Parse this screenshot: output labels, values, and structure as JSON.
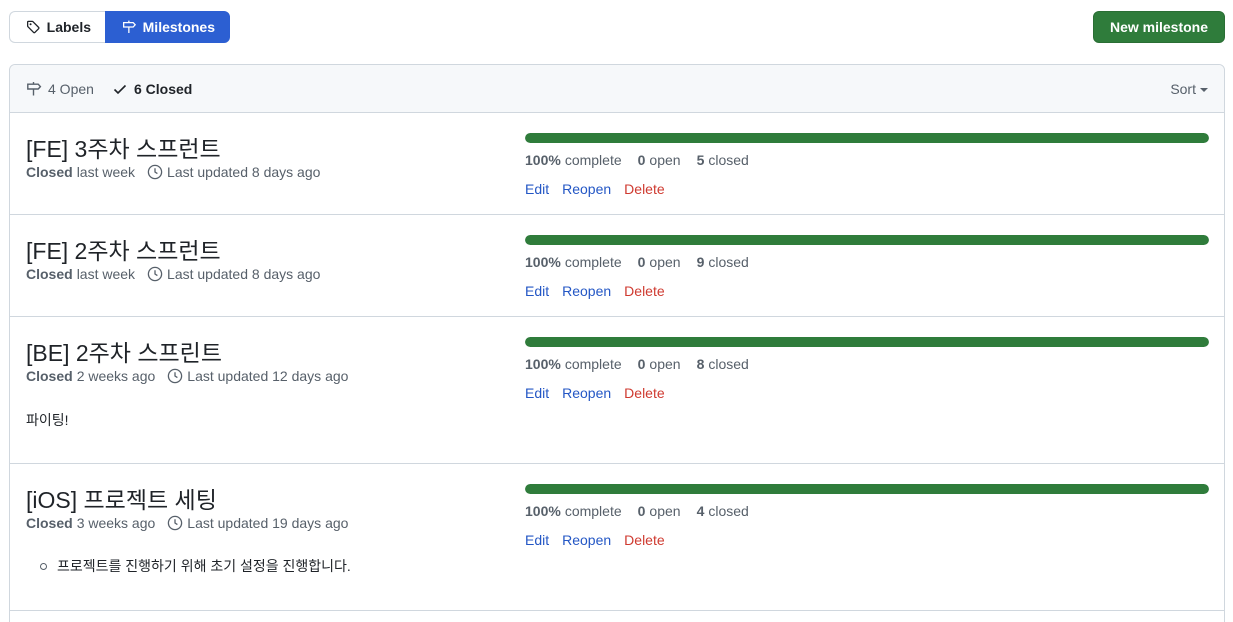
{
  "tabs": {
    "labels": "Labels",
    "milestones": "Milestones"
  },
  "new_milestone": "New milestone",
  "filter": {
    "open": "4 Open",
    "closed": "6 Closed",
    "sort": "Sort"
  },
  "colors": {
    "primary": "#2c5fd2",
    "success": "#2f7c3b",
    "danger": "#cf3a30",
    "link": "#2457c5"
  },
  "milestones": [
    {
      "title": "[FE] 3주차 스프런트",
      "closed_label": "Closed",
      "closed_when": "last week",
      "updated": "Last updated 8 days ago",
      "progress": 1.0,
      "percent": "100%",
      "percent_label": "complete",
      "open_count": "0",
      "open_label": "open",
      "closed_count": "5",
      "closed_text": "closed",
      "description": "",
      "description_list": [],
      "edit": "Edit",
      "reopen": "Reopen",
      "delete": "Delete"
    },
    {
      "title": "[FE] 2주차 스프런트",
      "closed_label": "Closed",
      "closed_when": "last week",
      "updated": "Last updated 8 days ago",
      "progress": 1.0,
      "percent": "100%",
      "percent_label": "complete",
      "open_count": "0",
      "open_label": "open",
      "closed_count": "9",
      "closed_text": "closed",
      "description": "",
      "description_list": [],
      "edit": "Edit",
      "reopen": "Reopen",
      "delete": "Delete"
    },
    {
      "title": "[BE] 2주차 스프린트",
      "closed_label": "Closed",
      "closed_when": "2 weeks ago",
      "updated": "Last updated 12 days ago",
      "progress": 1.0,
      "percent": "100%",
      "percent_label": "complete",
      "open_count": "0",
      "open_label": "open",
      "closed_count": "8",
      "closed_text": "closed",
      "description": "파이팅!",
      "description_list": [],
      "edit": "Edit",
      "reopen": "Reopen",
      "delete": "Delete"
    },
    {
      "title": "[iOS] 프로젝트 세팅",
      "closed_label": "Closed",
      "closed_when": "3 weeks ago",
      "updated": "Last updated 19 days ago",
      "progress": 1.0,
      "percent": "100%",
      "percent_label": "complete",
      "open_count": "0",
      "open_label": "open",
      "closed_count": "4",
      "closed_text": "closed",
      "description": "",
      "description_list": [
        "프로젝트를 진행하기 위해 초기 설정을 진행합니다."
      ],
      "edit": "Edit",
      "reopen": "Reopen",
      "delete": "Delete"
    }
  ]
}
